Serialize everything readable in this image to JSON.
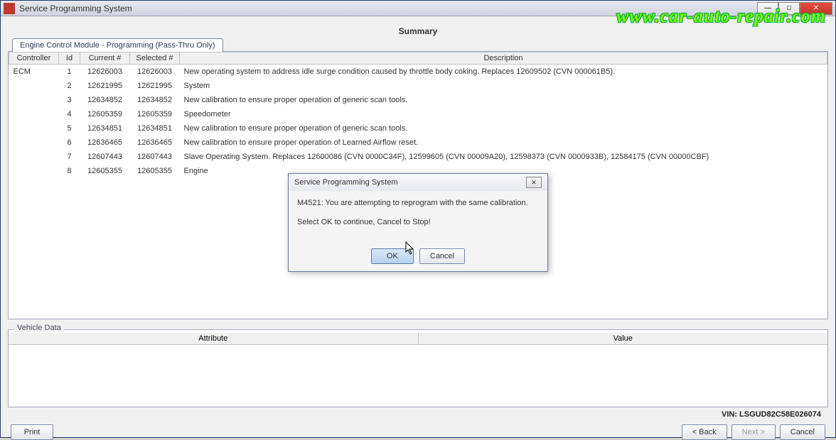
{
  "window": {
    "title": "Service Programming System"
  },
  "summary_title": "Summary",
  "tab_label": "Engine Control Module - Programming (Pass-Thru Only)",
  "columns": {
    "controller": "Controller",
    "id": "Id",
    "current": "Current #",
    "selected": "Selected #",
    "description": "Description"
  },
  "rows": [
    {
      "controller": "ECM",
      "id": "1",
      "current": "12626003",
      "selected": "12626003",
      "desc": "New operating system to address idle surge condition caused by throttle body coking. Replaces 12609502 (CVN 000061B5)."
    },
    {
      "controller": "",
      "id": "2",
      "current": "12621995",
      "selected": "12621995",
      "desc": "System"
    },
    {
      "controller": "",
      "id": "3",
      "current": "12634852",
      "selected": "12634852",
      "desc": "New calibration to ensure proper operation of generic scan tools."
    },
    {
      "controller": "",
      "id": "4",
      "current": "12605359",
      "selected": "12605359",
      "desc": "Speedometer"
    },
    {
      "controller": "",
      "id": "5",
      "current": "12634851",
      "selected": "12634851",
      "desc": "New calibration to ensure proper operation of generic scan tools."
    },
    {
      "controller": "",
      "id": "6",
      "current": "12636465",
      "selected": "12636465",
      "desc": "New calibration to ensure proper operation of Learned Airflow reset."
    },
    {
      "controller": "",
      "id": "7",
      "current": "12607443",
      "selected": "12607443",
      "desc": "Slave Operating System. Replaces 12600086 (CVN 0000C34F), 12599605 (CVN 00009A20), 12598373 (CVN 0000933B), 12584175 (CVN 00000CBF)"
    },
    {
      "controller": "",
      "id": "8",
      "current": "12605355",
      "selected": "12605355",
      "desc": "Engine"
    }
  ],
  "vehicle_data": {
    "label": "Vehicle Data",
    "attribute": "Attribute",
    "value": "Value"
  },
  "vin_label": "VIN: LSGUD82C58E026074",
  "footer": {
    "print": "Print",
    "back": "< Back",
    "next": "Next >",
    "cancel": "Cancel"
  },
  "dialog": {
    "title": "Service Programming System",
    "line1": "M4521: You are attempting to reprogram with the same calibration.",
    "line2": "Select OK to continue, Cancel to Stop!",
    "ok": "OK",
    "cancel": "Cancel"
  },
  "watermark": "www.car-auto-repair.com"
}
